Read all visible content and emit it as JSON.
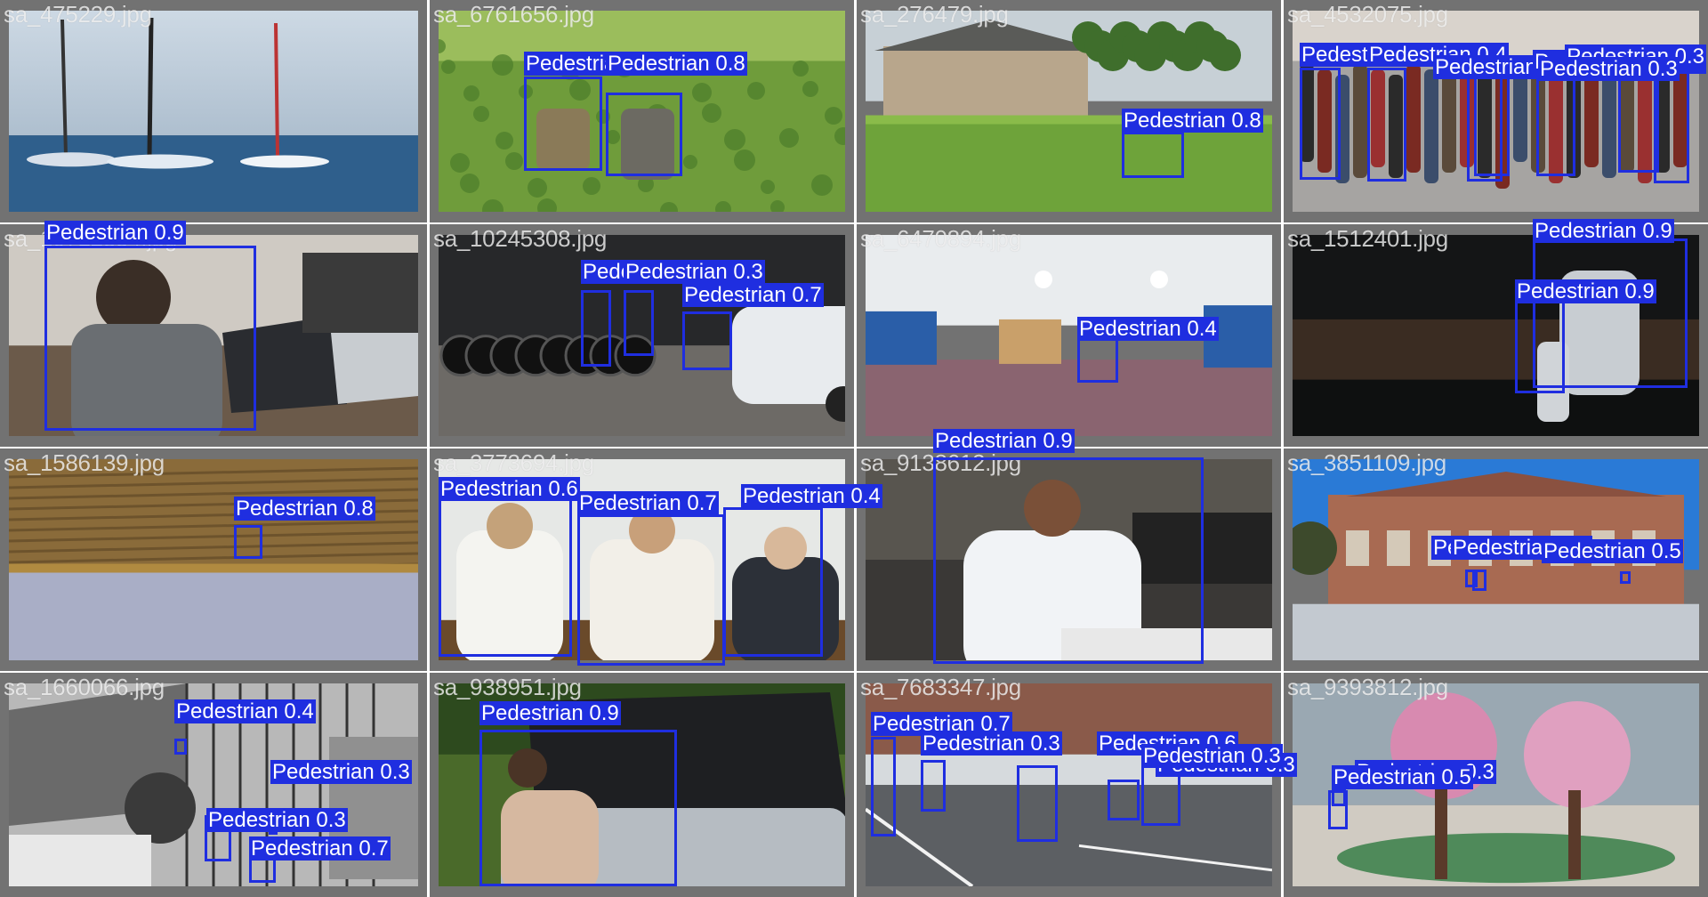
{
  "image": {
    "description_labels": "Object detection validation mosaic",
    "class_name": "Pedestrian",
    "box_color": "#1f2ee0",
    "tile_color": "#727272"
  },
  "tiles": [
    {
      "filename": "sa_475229.jpg",
      "scene": "sailboats-on-sea",
      "detections": []
    },
    {
      "filename": "sa_6761656.jpg",
      "scene": "farmers-in-field",
      "detections": [
        {
          "label": "Pedestrian 0.9"
        },
        {
          "label": "Pedestrian 0.8"
        }
      ]
    },
    {
      "filename": "sa_276479.jpg",
      "scene": "rice-field-house",
      "detections": [
        {
          "label": "Pedestrian 0.8"
        }
      ]
    },
    {
      "filename": "sa_4532075.jpg",
      "scene": "street-march",
      "detections": [
        {
          "label": "Pedestrian 0.4"
        },
        {
          "label": "Pedestrian 0.4"
        },
        {
          "label": "Pedestrian 0.3"
        },
        {
          "label": "Pedestrian 0.3"
        },
        {
          "label": "Pedestrian 0.3"
        },
        {
          "label": "Pedestrian 0.3"
        },
        {
          "label": "Pedestrian 0.3"
        }
      ]
    },
    {
      "filename": "sa_10712854.jpg",
      "scene": "laptop-office",
      "detections": [
        {
          "label": "Pedestrian 0.9"
        }
      ]
    },
    {
      "filename": "sa_10245308.jpg",
      "scene": "tire-shop",
      "detections": [
        {
          "label": "Pedestrian 0.3"
        },
        {
          "label": "Pedestrian 0.3"
        },
        {
          "label": "Pedestrian 0.7"
        }
      ]
    },
    {
      "filename": "sa_6470894.jpg",
      "scene": "panoramic-classroom",
      "detections": [
        {
          "label": "Pedestrian 0.4"
        }
      ]
    },
    {
      "filename": "sa_1512401.jpg",
      "scene": "skaters-dark-arena",
      "detections": [
        {
          "label": "Pedestrian 0.9"
        },
        {
          "label": "Pedestrian 0.9"
        }
      ]
    },
    {
      "filename": "sa_1586139.jpg",
      "scene": "flooded-paddy",
      "detections": [
        {
          "label": "Pedestrian 0.8"
        }
      ]
    },
    {
      "filename": "sa_3773694.jpg",
      "scene": "conference-panel",
      "detections": [
        {
          "label": "Pedestrian 0.6"
        },
        {
          "label": "Pedestrian 0.7"
        },
        {
          "label": "Pedestrian 0.4"
        }
      ]
    },
    {
      "filename": "sa_9138612.jpg",
      "scene": "nurse-hospital",
      "detections": [
        {
          "label": "Pedestrian 0.9"
        }
      ]
    },
    {
      "filename": "sa_3851109.jpg",
      "scene": "brick-building",
      "detections": [
        {
          "label": "Pedestrian 0.3"
        },
        {
          "label": "Pedestrian 0.3"
        },
        {
          "label": "Pedestrian 0.5"
        }
      ]
    },
    {
      "filename": "sa_1660066.jpg",
      "scene": "bw-industrial",
      "detections": [
        {
          "label": "Pedestrian 0.4"
        },
        {
          "label": "Pedestrian 0.3"
        },
        {
          "label": "Pedestrian 0.3"
        },
        {
          "label": "Pedestrian 0.7"
        }
      ]
    },
    {
      "filename": "sa_938951.jpg",
      "scene": "car-engine",
      "detections": [
        {
          "label": "Pedestrian 0.9"
        }
      ]
    },
    {
      "filename": "sa_7683347.jpg",
      "scene": "street-hockey",
      "detections": [
        {
          "label": "Pedestrian 0.7"
        },
        {
          "label": "Pedestrian 0.3"
        },
        {
          "label": "Pedestrian 0.6"
        },
        {
          "label": "Pedestrian 0.3"
        },
        {
          "label": "Pedestrian 0.3"
        }
      ]
    },
    {
      "filename": "sa_9393812.jpg",
      "scene": "mall-blossom-tree",
      "detections": [
        {
          "label": "Pedestrian 0.3"
        },
        {
          "label": "Pedestrian 0.5"
        }
      ]
    }
  ]
}
